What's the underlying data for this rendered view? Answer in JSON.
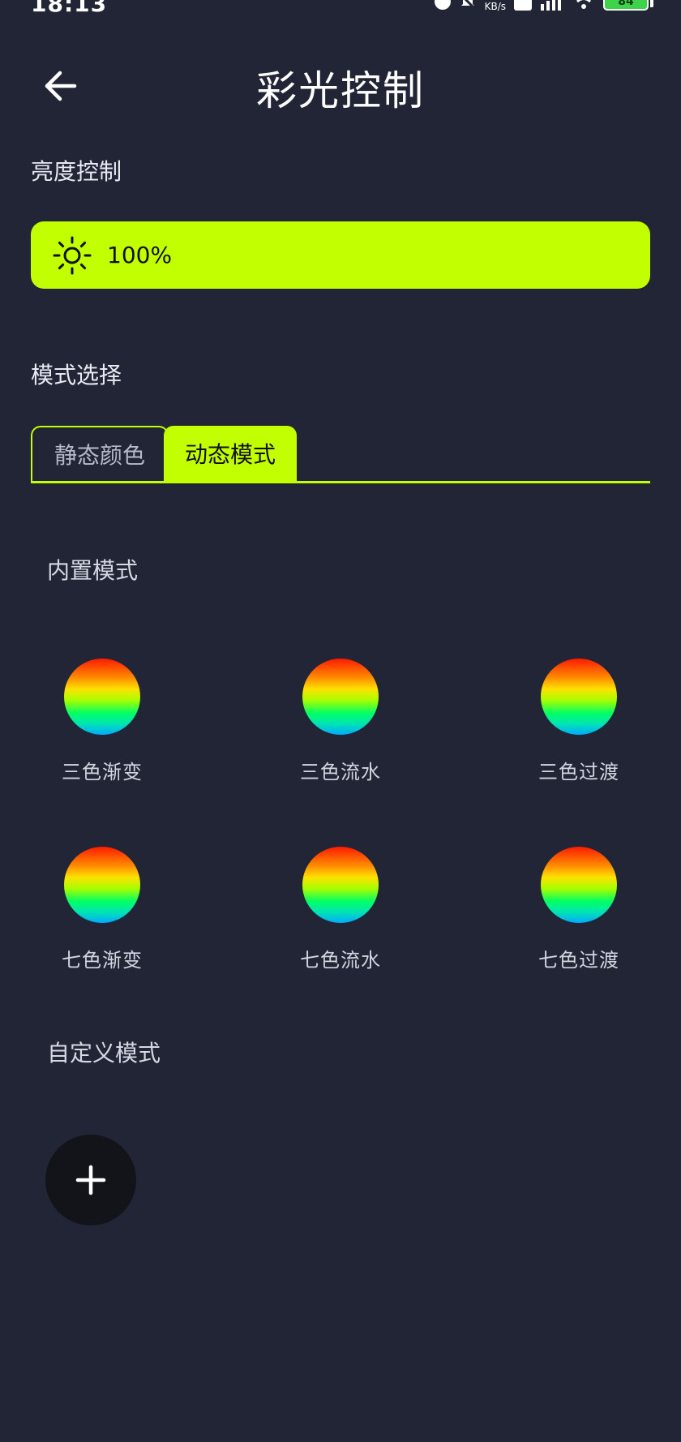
{
  "status_bar": {
    "time": "18:13",
    "network_speed": "KB/s",
    "battery": "84"
  },
  "header": {
    "title": "彩光控制"
  },
  "brightness": {
    "section_label": "亮度控制",
    "value": "100%",
    "level_percent": 100
  },
  "mode": {
    "section_label": "模式选择",
    "tabs": [
      {
        "label": "静态颜色",
        "active": false
      },
      {
        "label": "动态模式",
        "active": true
      }
    ]
  },
  "presets": {
    "section_label": "内置模式",
    "items": [
      {
        "label": "三色渐变"
      },
      {
        "label": "三色流水"
      },
      {
        "label": "三色过渡"
      },
      {
        "label": "七色渐变"
      },
      {
        "label": "七色流水"
      },
      {
        "label": "七色过渡"
      }
    ]
  },
  "custom": {
    "section_label": "自定义模式"
  },
  "colors": {
    "background": "#212536",
    "accent": "#c2ff00",
    "add_button_bg": "#121419",
    "battery_fill": "#3fd34b"
  },
  "icons": {
    "back": "arrow-left-icon",
    "brightness": "sun-icon",
    "add": "plus-icon"
  }
}
